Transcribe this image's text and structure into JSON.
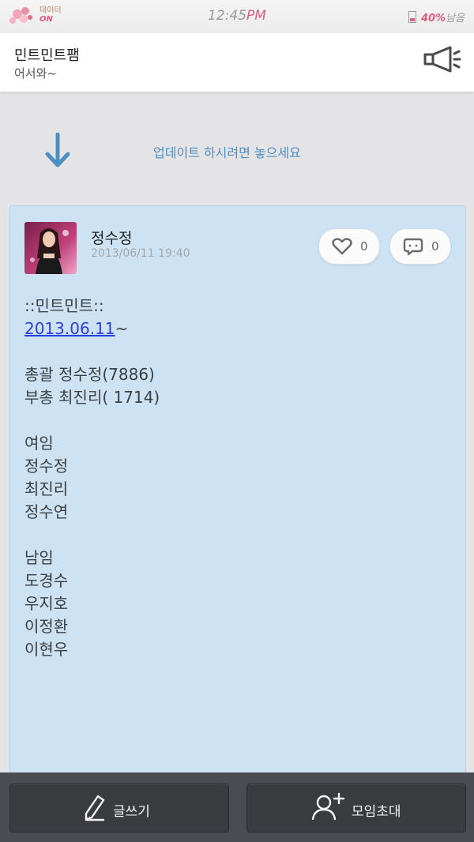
{
  "status_bar": {
    "data_label": "데이터",
    "data_state": "ON",
    "time": "12:45",
    "ampm": "PM",
    "battery_percent": "40%",
    "battery_suffix": "남음"
  },
  "header": {
    "title": "민트민트팸",
    "subtitle": "어서와~",
    "notice_icon": "megaphone-icon"
  },
  "pull_refresh": {
    "text": "업데이트 하시려면 놓으세요",
    "icon": "arrow-down-icon"
  },
  "post": {
    "author": "정수정",
    "date": "2013/06/11 19:40",
    "likes": "0",
    "comments": "0",
    "lines": [
      "::민트민트::",
      "",
      "",
      "총괄 정수정(7886)",
      "부총 최진리( 1714)",
      "",
      "여임",
      "정수정",
      "최진리",
      "정수연",
      "",
      "남임",
      "도경수",
      "우지호",
      "이정환",
      "이현우"
    ],
    "link_text": "2013.06.11",
    "link_suffix": "~"
  },
  "bottom_bar": {
    "write_label": "글쓰기",
    "invite_label": "모임초대"
  },
  "colors": {
    "accent_pink": "#e15d7e",
    "refresh_blue": "#4e8fc3",
    "card_bg": "#cde3f3",
    "bottom_bg": "#4b4c51"
  }
}
